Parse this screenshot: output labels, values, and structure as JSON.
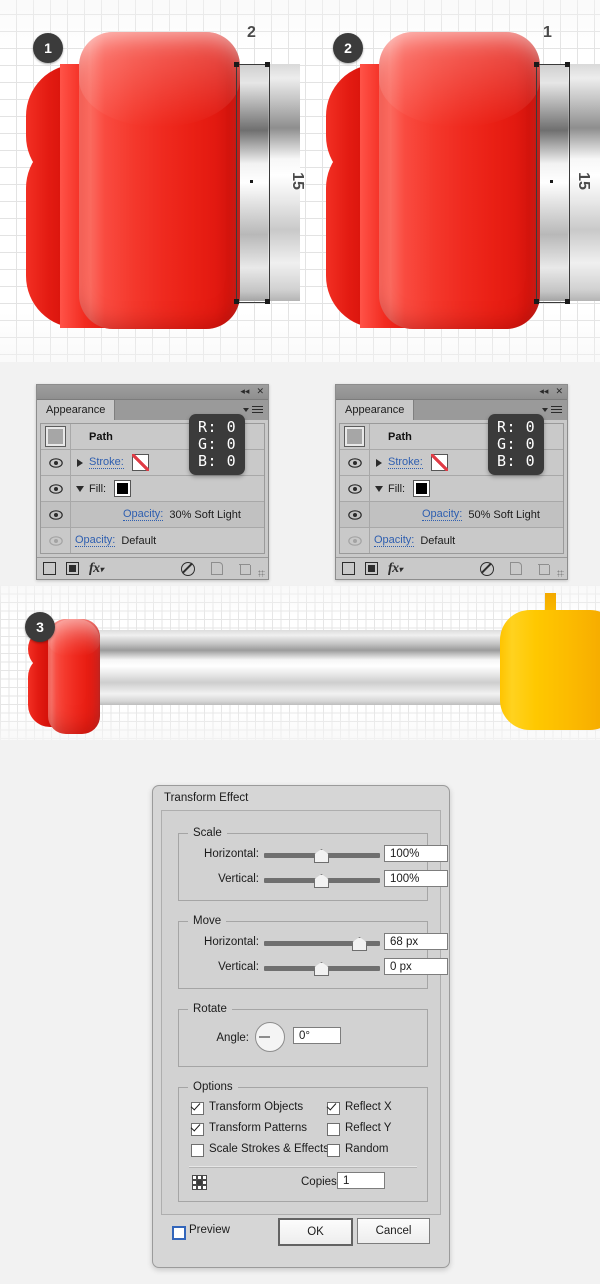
{
  "illustration_top": {
    "callouts": [
      {
        "id": "1",
        "label": "1"
      },
      {
        "id": "2",
        "label": "2"
      }
    ],
    "unit_left": {
      "callout": "1",
      "number_label": "2",
      "measure_label": "15"
    },
    "unit_right": {
      "callout": "2",
      "number_label": "1",
      "measure_label": "15"
    }
  },
  "appearance_panels": [
    {
      "title_tab": "Appearance",
      "collapse_icon": "collapse-icon",
      "close_icon": "close-icon",
      "menu_icon": "panel-menu-icon",
      "rows": [
        {
          "type": "object",
          "label": "Path"
        },
        {
          "type": "stroke",
          "label": "Stroke:",
          "swatch": "none"
        },
        {
          "type": "fill",
          "label": "Fill:",
          "swatch": "black"
        },
        {
          "type": "opacity_child",
          "label": "Opacity:",
          "value": "30% Soft Light"
        },
        {
          "type": "opacity_root",
          "label": "Opacity:",
          "value": "Default"
        }
      ],
      "tooltip": {
        "r": "R: 0",
        "g": "G: 0",
        "b": "B: 0"
      },
      "footer_icons": [
        "new-stroke-icon",
        "new-fill-icon",
        "fx-icon",
        "clear-appearance-icon",
        "duplicate-item-icon",
        "delete-item-icon"
      ]
    },
    {
      "title_tab": "Appearance",
      "collapse_icon": "collapse-icon",
      "close_icon": "close-icon",
      "menu_icon": "panel-menu-icon",
      "rows": [
        {
          "type": "object",
          "label": "Path"
        },
        {
          "type": "stroke",
          "label": "Stroke:",
          "swatch": "none"
        },
        {
          "type": "fill",
          "label": "Fill:",
          "swatch": "black"
        },
        {
          "type": "opacity_child",
          "label": "Opacity:",
          "value": "50% Soft Light"
        },
        {
          "type": "opacity_root",
          "label": "Opacity:",
          "value": "Default"
        }
      ],
      "tooltip": {
        "r": "R: 0",
        "g": "G: 0",
        "b": "B: 0"
      },
      "footer_icons": [
        "new-stroke-icon",
        "new-fill-icon",
        "fx-icon",
        "clear-appearance-icon",
        "duplicate-item-icon",
        "delete-item-icon"
      ]
    }
  ],
  "illustration_mid": {
    "callout": "3"
  },
  "dialog": {
    "title": "Transform Effect",
    "scale": {
      "legend": "Scale",
      "horizontal_label": "Horizontal:",
      "horizontal_value": "100%",
      "horizontal_slider_pct": 50,
      "vertical_label": "Vertical:",
      "vertical_value": "100%",
      "vertical_slider_pct": 50
    },
    "move": {
      "legend": "Move",
      "horizontal_label": "Horizontal:",
      "horizontal_value": "68 px",
      "horizontal_slider_pct": 80,
      "vertical_label": "Vertical:",
      "vertical_value": "0 px",
      "vertical_slider_pct": 50
    },
    "rotate": {
      "legend": "Rotate",
      "angle_label": "Angle:",
      "angle_value": "0°"
    },
    "options": {
      "legend": "Options",
      "checkboxes": [
        {
          "label": "Transform Objects",
          "checked": true
        },
        {
          "label": "Transform Patterns",
          "checked": true
        },
        {
          "label": "Scale Strokes & Effects",
          "checked": false
        },
        {
          "label": "Reflect X",
          "checked": true
        },
        {
          "label": "Reflect Y",
          "checked": false
        },
        {
          "label": "Random",
          "checked": false
        }
      ],
      "copies_label": "Copies",
      "copies_value": "1",
      "reference_point_icon": "reference-point-icon"
    },
    "preview_label": "Preview",
    "preview_checked": false,
    "ok_label": "OK",
    "cancel_label": "Cancel"
  },
  "colors": {
    "red_body": "#ee2a1f",
    "yellow_body": "#ffc400",
    "callout_bg": "#3b3b3b",
    "panel_bg": "#c9c9c9",
    "dialog_bg": "#d6d6d6",
    "link": "#2f5fb0"
  }
}
